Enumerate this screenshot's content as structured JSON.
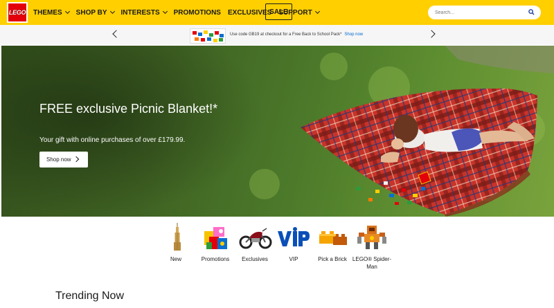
{
  "header": {
    "logo_text": "LEGO",
    "nav": [
      {
        "label": "THEMES",
        "has_dropdown": true
      },
      {
        "label": "SHOP BY",
        "has_dropdown": true
      },
      {
        "label": "INTERESTS",
        "has_dropdown": true
      },
      {
        "label": "PROMOTIONS",
        "has_dropdown": false
      },
      {
        "label": "EXCLUSIVES",
        "has_dropdown": false
      },
      {
        "label": "SUPPORT",
        "has_dropdown": true
      }
    ],
    "sale_label": "SALE",
    "search": {
      "placeholder": "Search...",
      "icon": "search-icon"
    },
    "colors": {
      "brand_yellow": "#ffcf00",
      "logo_red": "#e3000b",
      "link_blue": "#0066cc"
    }
  },
  "promo": {
    "text": "Use code GB19 at checkout for a Free Back to School Pack*",
    "link": "Shop now"
  },
  "hero": {
    "title": "FREE exclusive Picnic Blanket!*",
    "subtitle": "Your gift with online purchases of over £179.99.",
    "button": "Shop now"
  },
  "categories": [
    {
      "label": "New",
      "icon": "empire-state-building-icon"
    },
    {
      "label": "Promotions",
      "icon": "promotions-boxes-icon"
    },
    {
      "label": "Exclusives",
      "icon": "motorcycle-icon"
    },
    {
      "label": "VIP",
      "icon": "vip-logo-icon"
    },
    {
      "label": "Pick a Brick",
      "icon": "brick-icon"
    },
    {
      "label": "LEGO® Spider-Man",
      "icon": "spider-man-mech-icon"
    }
  ],
  "sections": {
    "trending_title": "Trending Now"
  }
}
